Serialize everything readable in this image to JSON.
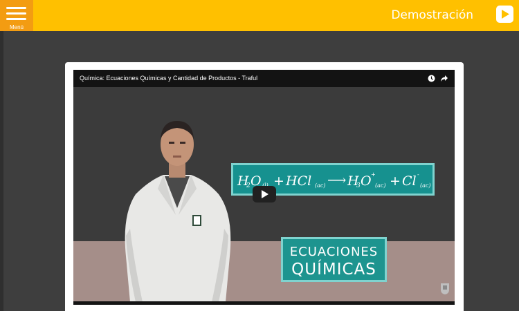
{
  "header": {
    "menu_label": "Menú",
    "title": "Demostración",
    "bg_color": "#ffc000",
    "menu_color": "#f39c12"
  },
  "video": {
    "title": "Química: Ecuaciones Químicas y Cantidad de Productos - Traful",
    "equation": {
      "h": "H",
      "h_sub": "2",
      "o1": "O",
      "o1_sub": "(l)",
      "plus1": "+",
      "hcl": "HCl",
      "hcl_sub": "(ac)",
      "arrow": "⟶",
      "h3": "H",
      "h3_sub": "3",
      "o3": "O",
      "o3_sup": "+",
      "o3_sub": "(ac)",
      "plus2": "+",
      "cl": "Cl",
      "cl_sup": "-",
      "cl_sub": "(ac)"
    },
    "topic_line1": "ECUACIONES",
    "topic_line2": "QUÍMICAS",
    "icons": [
      "clock-icon",
      "share-icon",
      "play-icon"
    ],
    "accent_color": "#16918f"
  }
}
